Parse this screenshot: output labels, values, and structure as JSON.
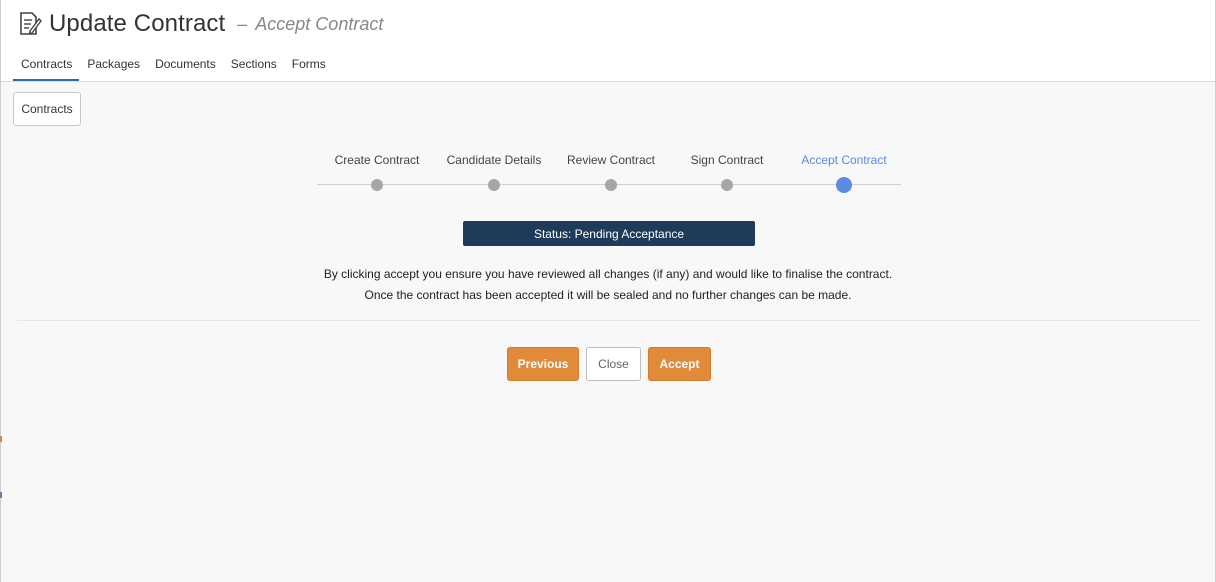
{
  "header": {
    "title": "Update Contract",
    "separator": "–",
    "subtitle": "Accept Contract",
    "icon": "edit-document-icon"
  },
  "nav": {
    "tabs": [
      {
        "label": "Contracts",
        "active": true
      },
      {
        "label": "Packages",
        "active": false
      },
      {
        "label": "Documents",
        "active": false
      },
      {
        "label": "Sections",
        "active": false
      },
      {
        "label": "Forms",
        "active": false
      }
    ]
  },
  "toolbar": {
    "contracts_button": "Contracts"
  },
  "stepper": {
    "steps": [
      {
        "label": "Create Contract",
        "active": false
      },
      {
        "label": "Candidate Details",
        "active": false
      },
      {
        "label": "Review Contract",
        "active": false
      },
      {
        "label": "Sign Contract",
        "active": false
      },
      {
        "label": "Accept Contract",
        "active": true
      }
    ],
    "colors": {
      "active": "#5b8ae0",
      "inactive": "#a6a6a6"
    }
  },
  "status": {
    "text": "Status: Pending Acceptance",
    "color": "#1f3b5a"
  },
  "info": {
    "line1": "By clicking accept you ensure you have reviewed all changes (if any) and would like to finalise the contract.",
    "line2": "Once the contract has been accepted it will be sealed and no further changes can be made."
  },
  "actions": {
    "previous_label": "Previous",
    "close_label": "Close",
    "accept_label": "Accept",
    "accent_color": "#e08a3a"
  }
}
